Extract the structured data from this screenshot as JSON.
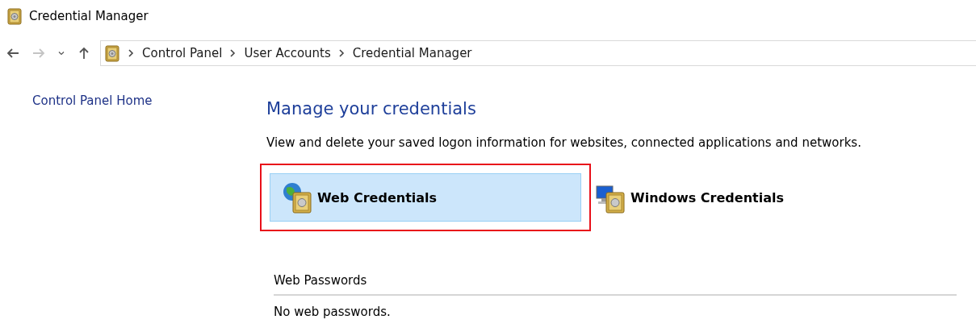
{
  "window": {
    "title": "Credential Manager"
  },
  "navigation": [
    {
      "kind": "back",
      "disabled": false
    },
    {
      "kind": "forward",
      "disabled": true
    },
    {
      "kind": "recent",
      "disabled": false
    },
    {
      "kind": "up",
      "disabled": false
    }
  ],
  "breadcrumbs": [
    "Control Panel",
    "User Accounts",
    "Credential Manager"
  ],
  "sidebar": {
    "items": [
      "Control Panel Home"
    ]
  },
  "main": {
    "heading": "Manage your credentials",
    "description": "View and delete your saved logon information for websites, connected applications and networks.",
    "credential_types": [
      {
        "kind": "web",
        "label": "Web Credentials",
        "selected": true,
        "highlighted": true
      },
      {
        "kind": "windows",
        "label": "Windows Credentials",
        "selected": false,
        "highlighted": false
      }
    ],
    "section": {
      "title": "Web Passwords",
      "empty_text": "No web passwords."
    }
  }
}
